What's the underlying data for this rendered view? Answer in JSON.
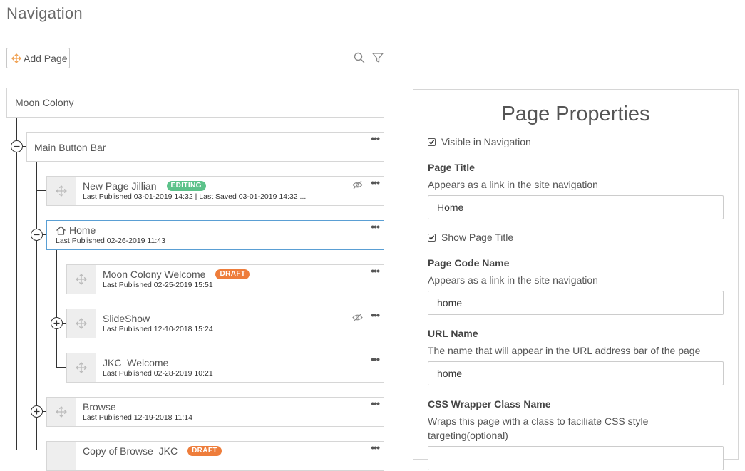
{
  "header": {
    "title": "Navigation"
  },
  "toolbar": {
    "add_page_label": "Add Page",
    "search_icon": "search-icon",
    "filter_icon": "filter-icon"
  },
  "tree": {
    "root": "Moon Colony",
    "main_button_bar": "Main Button Bar",
    "nodes": [
      {
        "name": "New Page Jillian",
        "badge": "EDITING",
        "subtitle": "Last Published 03-01-2019 14:32 | Last Saved 03-01-2019 14:32 ...",
        "hidden": true
      },
      {
        "name": "Home",
        "subtitle": "Last Published 02-26-2019 11:43",
        "selected": true
      },
      {
        "name": "Moon Colony Welcome",
        "badge": "DRAFT",
        "subtitle": "Last Published 02-25-2019 15:51"
      },
      {
        "name": "SlideShow",
        "subtitle": "Last Published 12-10-2018 15:24",
        "hidden": true
      },
      {
        "name": "JKC  Welcome",
        "subtitle": "Last Published 02-28-2019 10:21"
      },
      {
        "name": "Browse",
        "subtitle": "Last Published 12-19-2018 11:14"
      },
      {
        "name": "Copy of Browse  JKC",
        "badge": "DRAFT"
      }
    ],
    "more_glyph": "•••"
  },
  "colors": {
    "editing_badge": "#5cc28a",
    "draft_badge": "#ee7d3b",
    "selected_border": "#5a9fd4"
  },
  "properties": {
    "title": "Page Properties",
    "visible_in_nav": {
      "label": "Visible in Navigation",
      "checked": true
    },
    "page_title": {
      "label": "Page Title",
      "help": "Appears as a link in the site navigation",
      "value": "Home"
    },
    "show_page_title": {
      "label": "Show Page Title",
      "checked": true
    },
    "page_code_name": {
      "label": "Page Code Name",
      "help": "Appears as a link in the site navigation",
      "value": "home"
    },
    "url_name": {
      "label": "URL Name",
      "help": "The name that will appear in the URL address bar of the page",
      "value": "home"
    },
    "css_wrapper": {
      "label": "CSS Wrapper Class Name",
      "help": "Wraps this page with a class to faciliate CSS style targeting(optional)",
      "value": ""
    }
  }
}
